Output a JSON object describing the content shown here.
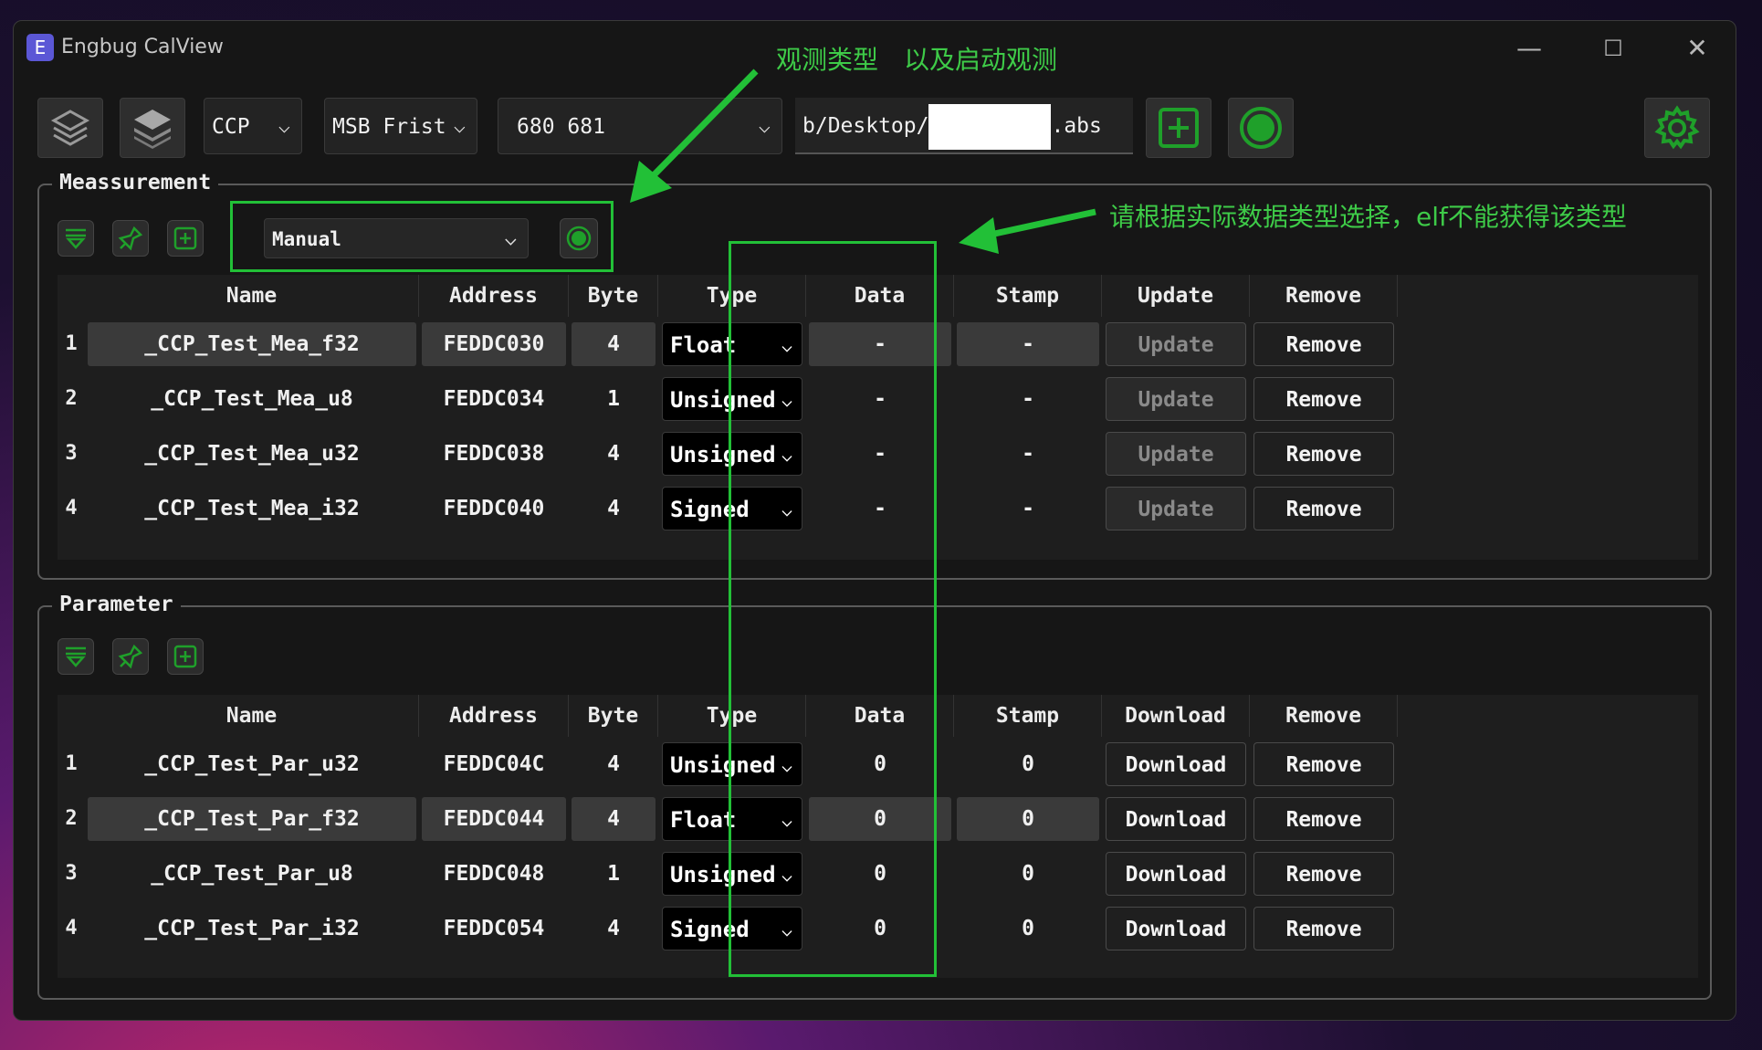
{
  "app": {
    "logo_letter": "E",
    "title": "Engbug CalView"
  },
  "window_controls": {
    "min": "—",
    "max": "☐",
    "close": "✕"
  },
  "toolbar": {
    "protocol": "CCP",
    "byte_order": "MSB Frist",
    "ids": "680 681",
    "file_path_prefix": "b/Desktop/",
    "file_path_suffix": ".abs",
    "chev": "⌵"
  },
  "measurement": {
    "title": "Meassurement",
    "mode": "Manual",
    "columns": [
      "Name",
      "Address",
      "Byte",
      "Type",
      "Data",
      "Stamp",
      "Update",
      "Remove"
    ],
    "rows": [
      {
        "num": "1",
        "name": "_CCP_Test_Mea_f32",
        "address": "FEDDC030",
        "byte": "4",
        "type": "Float",
        "data": "-",
        "stamp": "-",
        "action": "Update",
        "remove": "Remove"
      },
      {
        "num": "2",
        "name": "_CCP_Test_Mea_u8",
        "address": "FEDDC034",
        "byte": "1",
        "type": "Unsigned",
        "data": "-",
        "stamp": "-",
        "action": "Update",
        "remove": "Remove"
      },
      {
        "num": "3",
        "name": "_CCP_Test_Mea_u32",
        "address": "FEDDC038",
        "byte": "4",
        "type": "Unsigned",
        "data": "-",
        "stamp": "-",
        "action": "Update",
        "remove": "Remove"
      },
      {
        "num": "4",
        "name": "_CCP_Test_Mea_i32",
        "address": "FEDDC040",
        "byte": "4",
        "type": "Signed",
        "data": "-",
        "stamp": "-",
        "action": "Update",
        "remove": "Remove"
      }
    ]
  },
  "parameter": {
    "title": "Parameter",
    "columns": [
      "Name",
      "Address",
      "Byte",
      "Type",
      "Data",
      "Stamp",
      "Download",
      "Remove"
    ],
    "rows": [
      {
        "num": "1",
        "name": "_CCP_Test_Par_u32",
        "address": "FEDDC04C",
        "byte": "4",
        "type": "Unsigned",
        "data": "0",
        "stamp": "0",
        "action": "Download",
        "remove": "Remove"
      },
      {
        "num": "2",
        "name": "_CCP_Test_Par_f32",
        "address": "FEDDC044",
        "byte": "4",
        "type": "Float",
        "data": "0",
        "stamp": "0",
        "action": "Download",
        "remove": "Remove"
      },
      {
        "num": "3",
        "name": "_CCP_Test_Par_u8",
        "address": "FEDDC048",
        "byte": "1",
        "type": "Unsigned",
        "data": "0",
        "stamp": "0",
        "action": "Download",
        "remove": "Remove"
      },
      {
        "num": "4",
        "name": "_CCP_Test_Par_i32",
        "address": "FEDDC054",
        "byte": "4",
        "type": "Signed",
        "data": "0",
        "stamp": "0",
        "action": "Download",
        "remove": "Remove"
      }
    ]
  },
  "annotations": {
    "note_observe": "观测类型　以及启动观测",
    "note_type": "请根据实际数据类型选择，elf不能获得该类型"
  },
  "colors": {
    "annotation": "#22c037",
    "accent_green": "#1fa02a"
  }
}
